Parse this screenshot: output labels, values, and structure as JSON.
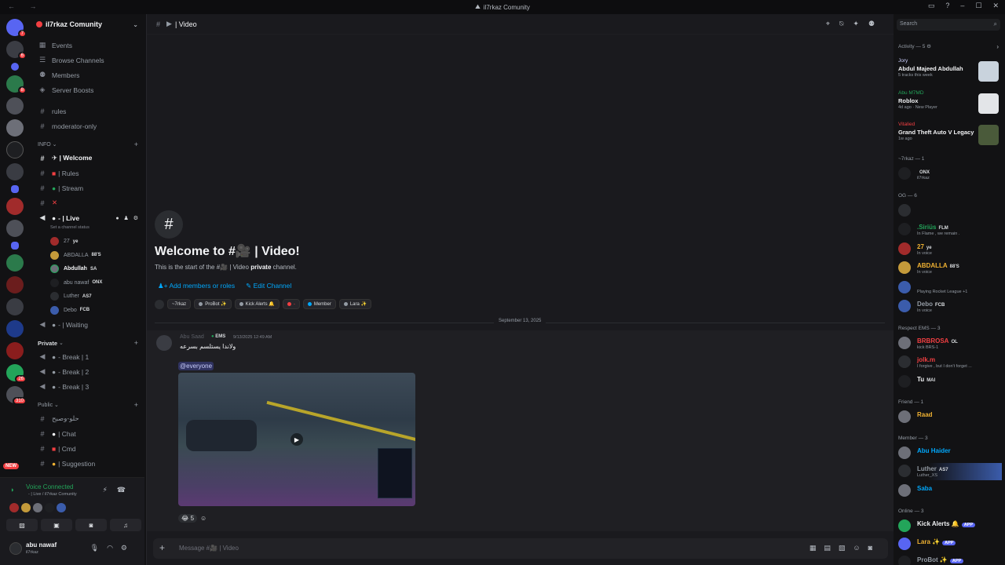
{
  "window": {
    "title": "il7rkaz Comunity",
    "nav": "← →",
    "controls": [
      "▭",
      "?",
      "–",
      "☐",
      "✕"
    ]
  },
  "server_rail": {
    "new_badge": "NEW",
    "badges": [
      "7",
      "6",
      "8",
      "26",
      "310"
    ]
  },
  "sidebar": {
    "server_name": "il7rkaz Comunity",
    "top_items": [
      "Events",
      "Browse Channels",
      "Members",
      "Server Boosts"
    ],
    "plain_channels": [
      "rules",
      "moderator-only"
    ],
    "info_category": "INFO",
    "info_channels": [
      "✈ | Welcome",
      "| Rules",
      "| Stream"
    ],
    "live_channel": "- | Live",
    "live_status": "Set a channel status",
    "voice_users": [
      {
        "name": "27",
        "tag": "ye"
      },
      {
        "name": "ABDALLA",
        "tag": "88'S"
      },
      {
        "name": "Abdullah",
        "tag": "SA"
      },
      {
        "name": "abu nawaf",
        "tag": "ONX"
      },
      {
        "name": "Luther",
        "tag": "AS7"
      },
      {
        "name": "Debo",
        "tag": "FCB"
      }
    ],
    "waiting_channel": "- | Waiting",
    "private_category": "Private",
    "private_channels": [
      "- Break | 1",
      "- Break | 2",
      "- Break | 3"
    ],
    "public_category": "Public",
    "public_channels": [
      "حلو-وصبح",
      "| Chat",
      "| Cmd",
      "| Suggestion"
    ]
  },
  "voice_panel": {
    "status": "Voice Connected",
    "location": "- | Live / il7rkaz Comunity"
  },
  "user_panel": {
    "name": "abu nawaf",
    "status": "il7rkaz"
  },
  "chat": {
    "channel_name": "| Video",
    "welcome_title": "Welcome to #🎥 | Video!",
    "welcome_desc_prefix": "This is the start of the #🎥 | Video",
    "welcome_desc_bold": "private",
    "welcome_desc_suffix": "channel.",
    "add_members": "Add members or roles",
    "edit_channel": "Edit Channel",
    "roles": [
      "~7rkaz",
      "ProBot ✨",
      "Kick Alerts 🔔",
      "-",
      "Member",
      "Lara ✨"
    ],
    "date_separator": "September 13, 2025",
    "message": {
      "author": "Abu Saad",
      "tag": "EMS",
      "time": "9/13/2025 12:49 AM",
      "text": "ولاندا يستلسم بسرعه",
      "mention": "@everyone",
      "reaction_count": "5"
    },
    "composer_placeholder": "Message #🎥 | Video"
  },
  "members": {
    "search_placeholder": "Search",
    "activity_header": "Activity — 5",
    "activities": [
      {
        "who": "Jory",
        "game": "Abdul Majeed Abdullah",
        "sub": "5 tracks this week"
      },
      {
        "who": "Abu M7MD",
        "game": "Roblox",
        "sub": "4d ago · New Player"
      },
      {
        "who": "Vitalied",
        "game": "Grand Theft Auto V Legacy",
        "sub": "1w ago"
      }
    ],
    "groups": [
      {
        "header": "~7rkaz — 1",
        "items": [
          {
            "name": "",
            "tag": "ONX",
            "sub": "il7rkaz"
          }
        ]
      },
      {
        "header": "OG — 6",
        "items": [
          {
            "name": "",
            "tag": "",
            "sub": ""
          },
          {
            "name": ".Siriüs",
            "tag": "FLM",
            "sub": "In Flame , we remain ."
          },
          {
            "name": "27",
            "tag": "ye",
            "sub": "In voice"
          },
          {
            "name": "ABDALLA",
            "tag": "88'S",
            "sub": "In voice"
          },
          {
            "name": "",
            "tag": "",
            "sub": "Playing Rocket League +1"
          },
          {
            "name": "Debo",
            "tag": "FCB",
            "sub": "In voice"
          }
        ]
      },
      {
        "header": "Respect EMS — 3",
        "items": [
          {
            "name": "BRBROSA",
            "tag": "OL",
            "sub": "kick BRS-1"
          },
          {
            "name": "jolk.m",
            "tag": "",
            "sub": "I forgive , but I don't forget ..."
          },
          {
            "name": "Tu",
            "tag": "MAI",
            "sub": ""
          }
        ]
      },
      {
        "header": "Friend — 1",
        "items": [
          {
            "name": "Raad",
            "tag": "",
            "sub": ""
          }
        ]
      },
      {
        "header": "Member — 3",
        "items": [
          {
            "name": "Abu Haider",
            "tag": "",
            "sub": ""
          },
          {
            "name": "Luther",
            "tag": "AS7",
            "sub": "Luther_XS"
          },
          {
            "name": "Saba",
            "tag": "",
            "sub": ""
          }
        ]
      },
      {
        "header": "Online — 3",
        "items": [
          {
            "name": "Kick Alerts 🔔",
            "tag": "APP",
            "sub": ""
          },
          {
            "name": "Lara ✨",
            "tag": "APP",
            "sub": ""
          },
          {
            "name": "ProBot ✨",
            "tag": "APP",
            "sub": ""
          }
        ]
      }
    ]
  },
  "colors": {
    "accent": "#5865f2",
    "online": "#23a55a",
    "danger": "#f23f42",
    "link": "#00a8fc"
  }
}
